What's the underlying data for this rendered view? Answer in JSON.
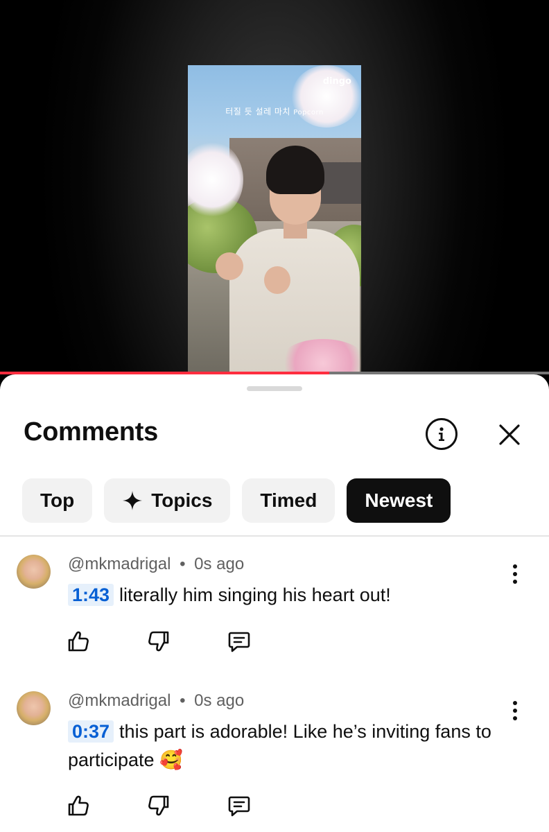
{
  "video": {
    "caption_korean": "터질 듯 설레 마치",
    "caption_english": "Popcorn",
    "channel_logo": "dingo",
    "progress_fraction": 0.6
  },
  "sheet": {
    "title": "Comments",
    "info_icon": "info-circle-icon",
    "close_icon": "close-icon"
  },
  "sort_chips": [
    {
      "label": "Top",
      "active": false
    },
    {
      "label": "Topics",
      "icon": "sparkle-icon",
      "active": false
    },
    {
      "label": "Timed",
      "active": false
    },
    {
      "label": "Newest",
      "active": true
    }
  ],
  "comments": [
    {
      "author": "@mkmadrigal",
      "separator": "•",
      "age": "0s ago",
      "timestamp": "1:43",
      "text": "literally him singing his heart out!"
    },
    {
      "author": "@mkmadrigal",
      "separator": "•",
      "age": "0s ago",
      "timestamp": "0:37",
      "text": "this part is adorable! Like he’s inviting fans to participate 🥰"
    }
  ],
  "action_icons": [
    "thumbs-up-icon",
    "thumbs-down-icon",
    "reply-icon"
  ],
  "colors": {
    "progress": "#ff2d3f",
    "timestamp_text": "#065fd4",
    "timestamp_bg": "#e6f0fb",
    "active_chip": "#0f0f0f"
  }
}
